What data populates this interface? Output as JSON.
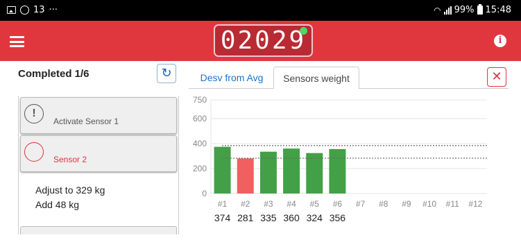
{
  "status_bar": {
    "left_text": "13",
    "more": "···",
    "battery": "99%",
    "time": "15:48"
  },
  "header": {
    "counter": "02029",
    "counter_dot_color": "#4cd964",
    "background_color": "#e0373f",
    "menu_icon": "hamburger-icon",
    "info_icon_glyph": "i"
  },
  "left_panel": {
    "title": "Completed 1/6",
    "refresh_icon": "↻",
    "steps": [
      {
        "icon": "!",
        "label": "Activate Sensor 1",
        "state": "done"
      },
      {
        "icon": "!",
        "label": "Sensor 2",
        "state": "active"
      }
    ],
    "detail_lines": [
      "Adjust to 329 kg",
      "Add 48 kg"
    ]
  },
  "right_panel": {
    "tabs": [
      {
        "label": "Desv from Avg",
        "selected": false
      },
      {
        "label": "Sensors weight",
        "selected": true
      }
    ],
    "close_glyph": "✕"
  },
  "chart_data": {
    "type": "bar",
    "categories": [
      "#1",
      "#2",
      "#3",
      "#4",
      "#5",
      "#6",
      "#7",
      "#8",
      "#9",
      "#10",
      "#11",
      "#12"
    ],
    "values": [
      374,
      281,
      335,
      360,
      324,
      356,
      null,
      null,
      null,
      null,
      null,
      null
    ],
    "value_labels": [
      "374",
      "281",
      "335",
      "360",
      "324",
      "356"
    ],
    "bar_colors": [
      "#43a047",
      "#f06060",
      "#43a047",
      "#43a047",
      "#43a047",
      "#43a047"
    ],
    "yticks": [
      0,
      200,
      400,
      600,
      750
    ],
    "ylim": [
      0,
      750
    ],
    "reference_lines": [
      384,
      283
    ],
    "grid": true,
    "title": "",
    "xlabel": "",
    "ylabel": ""
  }
}
